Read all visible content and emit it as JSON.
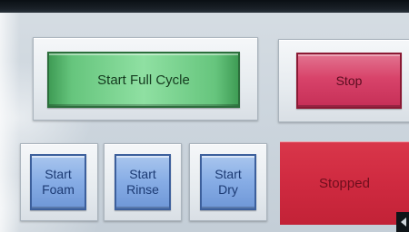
{
  "controls": {
    "start_full_cycle_label": "Start Full Cycle",
    "stop_label": "Stop",
    "start_foam_label": "Start\nFoam",
    "start_rinse_label": "Start\nRinse",
    "start_dry_label": "Start\nDry"
  },
  "status": {
    "text": "Stopped",
    "color": "#cf2a40"
  },
  "colors": {
    "start_button": "#66c57d",
    "stop_button": "#d8436a",
    "step_buttons": "#86ace5",
    "background": "#cdd6de"
  },
  "icons": {
    "corner": "scroll-left-arrow-icon"
  }
}
